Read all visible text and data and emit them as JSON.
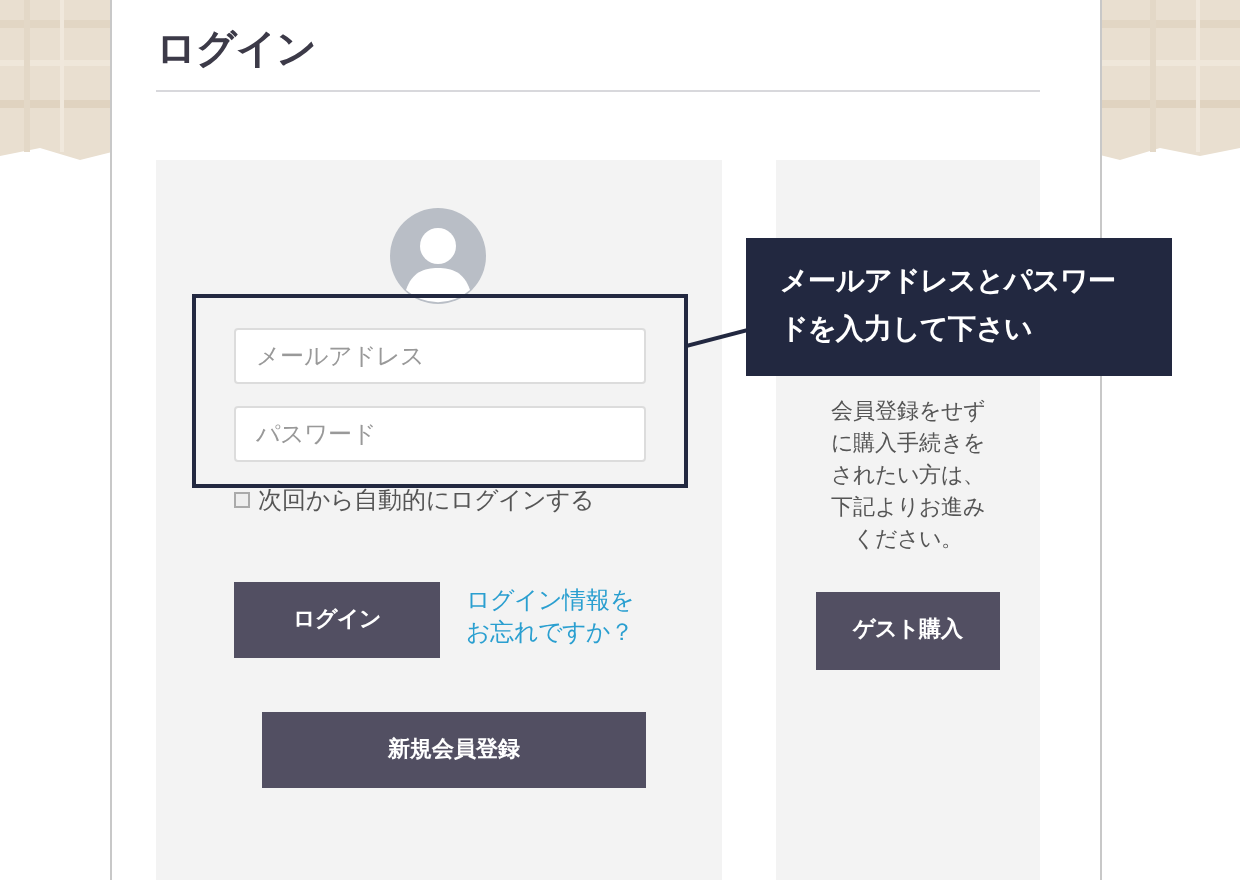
{
  "page": {
    "title": "ログイン"
  },
  "login_panel": {
    "email": {
      "placeholder": "メールアドレス"
    },
    "password": {
      "placeholder": "パスワード"
    },
    "remember": {
      "label": "次回から自動的にログインする",
      "checked": false
    },
    "login_button": "ログイン",
    "forgot_link": "ログイン情報をお忘れですか？",
    "register_button": "新規会員登録"
  },
  "guest_panel": {
    "text": "会員登録をせずに購入手続きをされたい方は、下記よりお進みください。",
    "button": "ゲスト購入"
  },
  "callout": {
    "text": "メールアドレスとパスワードを入力して下さい"
  }
}
